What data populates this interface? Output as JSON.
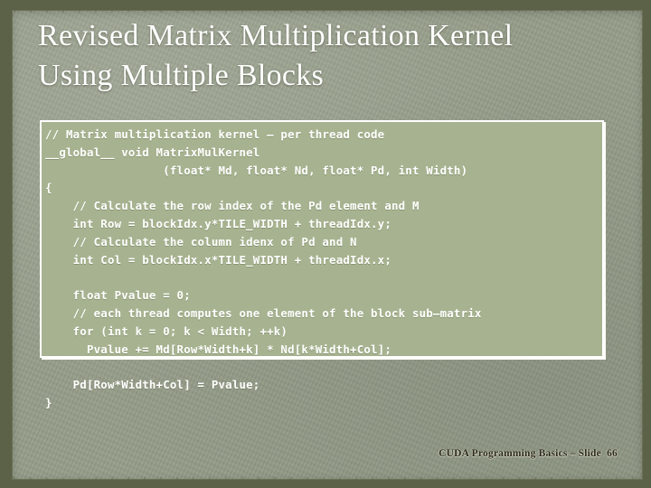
{
  "slide": {
    "title": "Revised Matrix Multiplication Kernel\nUsing Multiple Blocks",
    "background_color": "#969e8a",
    "frame_color": "#5c6247"
  },
  "code_panel": {
    "background_color": "#a7b390",
    "border_color": "#ffffff",
    "text_color": "#ffffff",
    "language": "cuda-c",
    "lines": [
      "// Matrix multiplication kernel – per thread code",
      "__global__ void MatrixMulKernel",
      "                 (float* Md, float* Nd, float* Pd, int Width)",
      "{",
      "    // Calculate the row index of the Pd element and M",
      "    int Row = blockIdx.y*TILE_WIDTH + threadIdx.y;",
      "    // Calculate the column idenx of Pd and N",
      "    int Col = blockIdx.x*TILE_WIDTH + threadIdx.x;",
      "",
      "    float Pvalue = 0;",
      "    // each thread computes one element of the block sub–matrix",
      "    for (int k = 0; k < Width; ++k)",
      "      Pvalue += Md[Row*Width+k] * Nd[k*Width+Col];",
      "",
      "    Pd[Row*Width+Col] = Pvalue;",
      "}"
    ],
    "text": "// Matrix multiplication kernel – per thread code\n__global__ void MatrixMulKernel\n                 (float* Md, float* Nd, float* Pd, int Width)\n{\n    // Calculate the row index of the Pd element and M\n    int Row = blockIdx.y*TILE_WIDTH + threadIdx.y;\n    // Calculate the column idenx of Pd and N\n    int Col = blockIdx.x*TILE_WIDTH + threadIdx.x;\n\n    float Pvalue = 0;\n    // each thread computes one element of the block sub–matrix\n    for (int k = 0; k < Width; ++k)\n      Pvalue += Md[Row*Width+k] * Nd[k*Width+Col];\n\n    Pd[Row*Width+Col] = Pvalue;\n}"
  },
  "footer": {
    "text": "CUDA Programming Basics – Slide  66",
    "course": "CUDA Programming Basics",
    "separator": "–",
    "slide_label": "Slide",
    "slide_number": "66",
    "text_color": "#2e2a1d"
  }
}
